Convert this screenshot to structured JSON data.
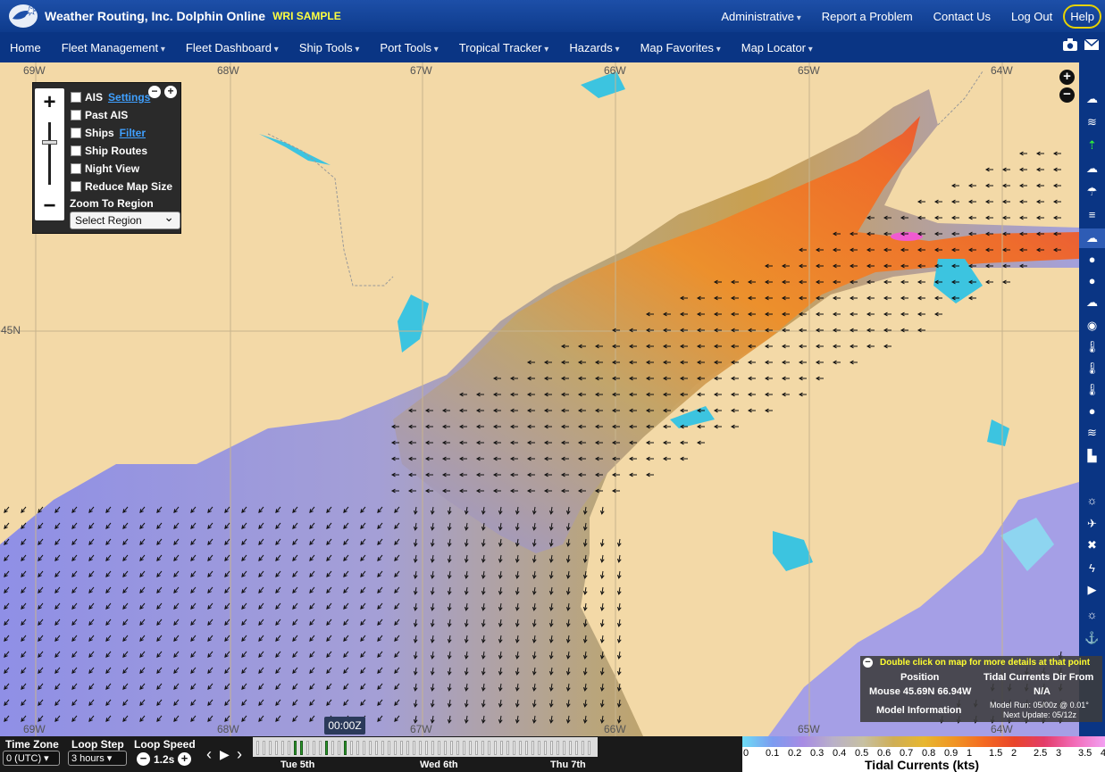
{
  "header": {
    "brand": "Weather Routing, Inc. Dolphin Online",
    "sample_tag": "WRI SAMPLE",
    "links": [
      "Administrative",
      "Report a Problem",
      "Contact Us",
      "Log Out"
    ],
    "help": "Help"
  },
  "nav": {
    "items": [
      "Home",
      "Fleet Management",
      "Fleet Dashboard",
      "Ship Tools",
      "Port Tools",
      "Tropical Tracker",
      "Hazards",
      "Map Favorites",
      "Map Locator"
    ]
  },
  "map": {
    "lon_labels": [
      "69W",
      "68W",
      "67W",
      "66W",
      "65W",
      "64W"
    ],
    "lat_labels": [
      "45N"
    ]
  },
  "layers": {
    "items": [
      {
        "label": "AIS",
        "link": "Settings"
      },
      {
        "label": "Past AIS",
        "link": ""
      },
      {
        "label": "Ships",
        "link": "Filter"
      },
      {
        "label": "Ship Routes",
        "link": ""
      },
      {
        "label": "Night View",
        "link": ""
      },
      {
        "label": "Reduce Map Size",
        "link": ""
      }
    ],
    "zoom_to_region": "Zoom To Region",
    "region_select": "Select Region"
  },
  "info": {
    "hint": "Double click on map for more details at that point",
    "col_position": "Position",
    "col_param": "Tidal Currents Dir From",
    "mouse": "Mouse 45.69N 66.94W",
    "value": "N/A",
    "model_info": "Model Information",
    "model_run": "Model Run: 05/00z @ 0.01°",
    "next_update": "Next Update: 05/12z"
  },
  "controls": {
    "time_zone_label": "Time Zone",
    "time_zone_value": "0 (UTC)",
    "loop_step_label": "Loop Step",
    "loop_step_value": "3 hours",
    "loop_speed_label": "Loop Speed",
    "loop_speed_value": "1.2s",
    "current_time": "00:00Z",
    "days": [
      "Tue 5th",
      "Wed 6th",
      "Thu 7th"
    ]
  },
  "legend": {
    "title": "Tidal Currents (kts)",
    "ticks": [
      "0",
      "0.1",
      "0.2",
      "0.3",
      "0.4",
      "0.5",
      "0.6",
      "0.7",
      "0.8",
      "0.9",
      "1",
      "1.5",
      "2",
      "2.5",
      "3",
      "3.5",
      "4"
    ]
  }
}
